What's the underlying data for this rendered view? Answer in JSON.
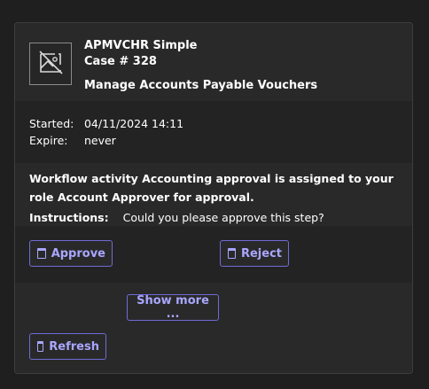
{
  "card": {
    "app_name": "APMVCHR Simple",
    "case_number": "Case # 328",
    "process_name": "Manage Accounts Payable Vouchers",
    "thumbnail_icon": "image-unavailable-icon"
  },
  "meta": {
    "started_label": "Started:",
    "started_value": "04/11/2024 14:11",
    "expire_label": "Expire:",
    "expire_value": "never"
  },
  "message": "Workflow activity Accounting approval is assigned to your role Account Approver for approval.",
  "instructions": {
    "label": "Instructions:",
    "value": "Could you please approve this step?"
  },
  "actions": {
    "approve_label": "Approve",
    "reject_label": "Reject",
    "button_icon": "window-icon"
  },
  "show_more_label": "Show more ...",
  "refresh_label": "Refresh",
  "colors": {
    "page_background": "#1f1f1f",
    "card_background": "#292929",
    "section_background": "#232323",
    "accent": "#a9a6ff",
    "accent_border": "#6f6bd6"
  }
}
